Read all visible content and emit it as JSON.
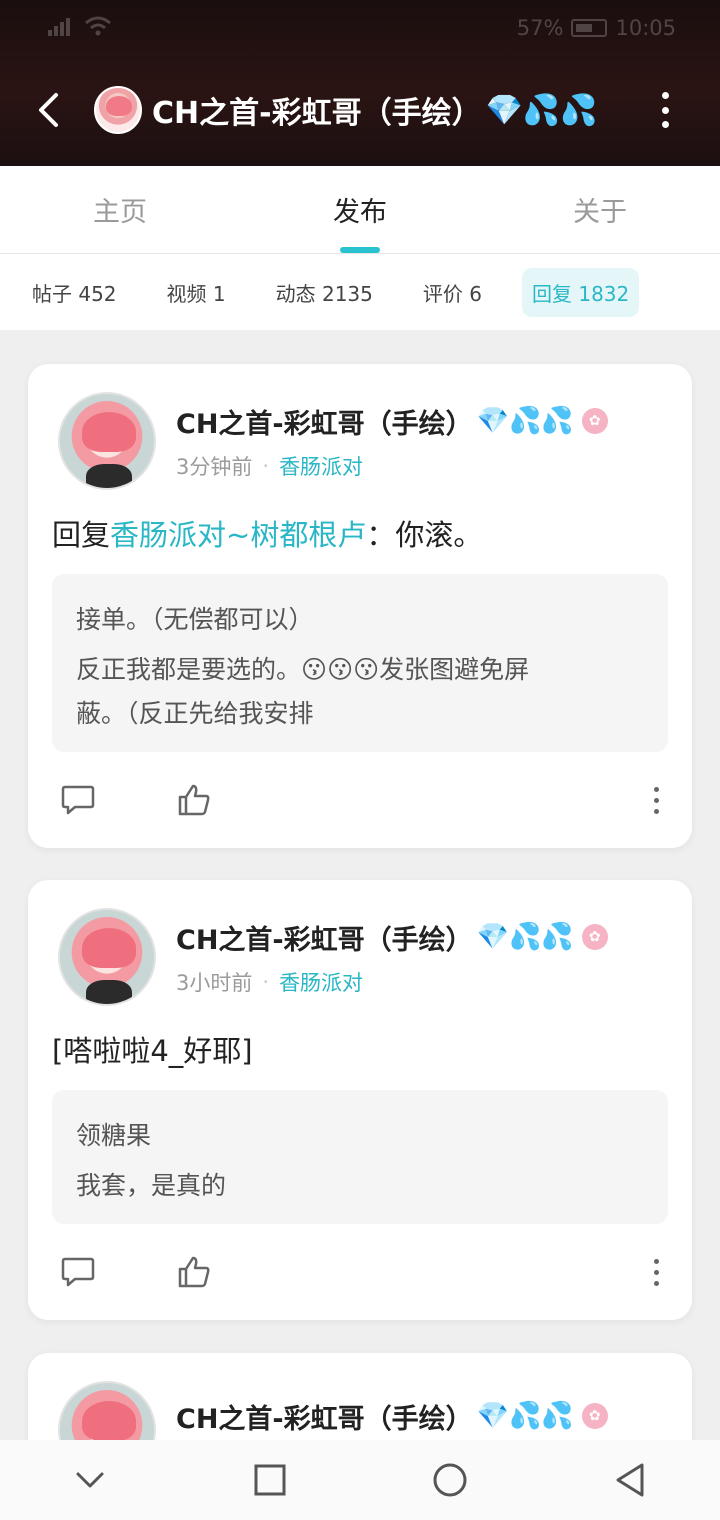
{
  "status_bar": {
    "battery": "57%",
    "time": "10:05"
  },
  "header": {
    "title": "CH之首-彩虹哥（手绘）",
    "title_emoji": "💎💦💦"
  },
  "tabs": [
    {
      "label": "主页"
    },
    {
      "label": "发布",
      "active": true
    },
    {
      "label": "关于"
    }
  ],
  "chips": [
    {
      "label": "帖子 452"
    },
    {
      "label": "视频 1"
    },
    {
      "label": "动态 2135"
    },
    {
      "label": "评价 6"
    },
    {
      "label": "回复 1832",
      "active": true
    }
  ],
  "posts": [
    {
      "author": "CH之首-彩虹哥（手绘）",
      "author_emoji": "💎💦💦",
      "time": "3分钟前",
      "group": "香肠派对",
      "reply_prefix": "回复",
      "mention": "香肠派对~树都根卢",
      "reply_text": "：你滚。",
      "quote_lines": [
        "接单。（无偿都可以）",
        "反正我都是要选的。😗😗😗发张图避免屏",
        "蔽。（反正先给我安排"
      ]
    },
    {
      "author": "CH之首-彩虹哥（手绘）",
      "author_emoji": "💎💦💦",
      "time": "3小时前",
      "group": "香肠派对",
      "text": "[嗒啦啦4_好耶]",
      "quote_lines": [
        "领糖果",
        "我套，是真的"
      ]
    },
    {
      "author": "CH之首-彩虹哥（手绘）",
      "author_emoji": "💎💦💦"
    }
  ],
  "colors": {
    "accent": "#29b6c5",
    "header_bg": "#1f1010",
    "page_bg": "#efefef"
  }
}
